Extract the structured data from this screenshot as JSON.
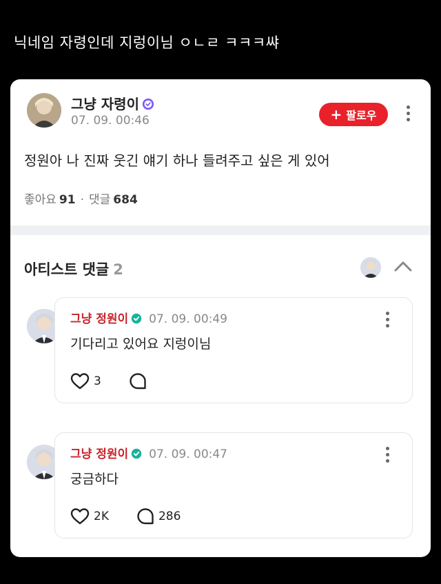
{
  "caption": "닉네임 자령인데  지렁이님 ㅇㄴㄹ ㅋㅋㅋ쌰",
  "post": {
    "author": "그냥 자령이",
    "time": "07. 09. 00:46",
    "follow_label": "팔로우",
    "follow_plus": "+",
    "text": "정원아 나 진짜 웃긴 얘기 하나 들려주고 싶은 게 있어",
    "likes_label": "좋아요",
    "likes": "91",
    "separator": "·",
    "comments_label": "댓글",
    "comments": "684"
  },
  "artist_section": {
    "title": "아티스트 댓글",
    "count": "2"
  },
  "comments": [
    {
      "author": "그냥 정원이",
      "time": "07. 09. 00:49",
      "text": "기다리고 있어요 지렁이님",
      "likes": "3",
      "replies": ""
    },
    {
      "author": "그냥 정원이",
      "time": "07. 09. 00:47",
      "text": "궁금하다",
      "likes": "2K",
      "replies": "286"
    }
  ],
  "colors": {
    "follow_bg": "#e8212a",
    "artist_name": "#c8232b",
    "user_badge": "#7b5cf5",
    "artist_badge": "#16b39a"
  },
  "icons": [
    "verified-badge-icon",
    "plus-icon",
    "more-vertical-icon",
    "chevron-up-icon",
    "heart-icon",
    "comment-bubble-icon"
  ]
}
